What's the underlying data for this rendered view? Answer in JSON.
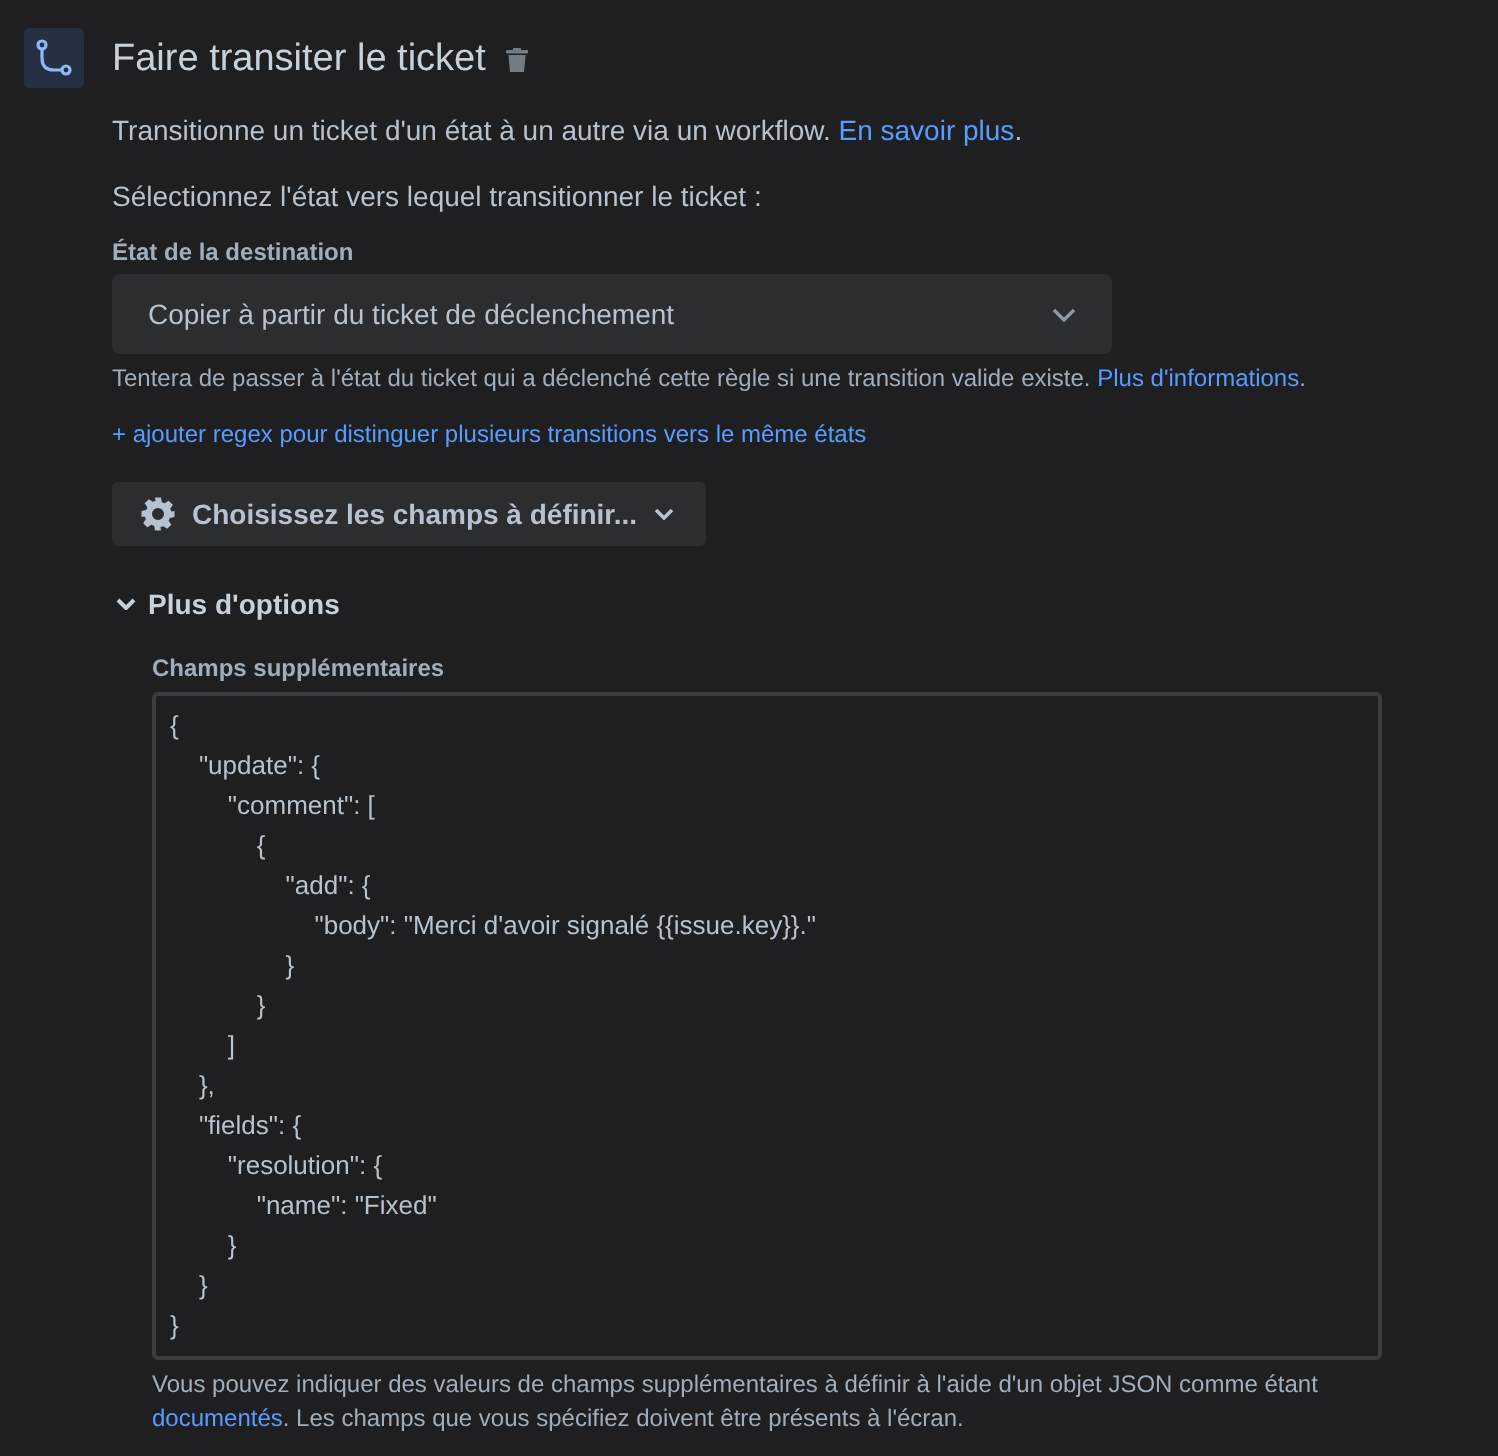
{
  "header": {
    "title": "Faire transiter le ticket"
  },
  "description": {
    "before": "Transitionne un ticket d'un état à un autre via un workflow. ",
    "link": "En savoir plus",
    "after": "."
  },
  "prompt": "Sélectionnez l'état vers lequel transitionner le ticket :",
  "destination": {
    "label": "État de la destination",
    "value": "Copier à partir du ticket de déclenchement",
    "help": {
      "before": "Tentera de passer à l'état du ticket qui a déclenché cette règle si une transition valide existe. ",
      "link": "Plus d'informations",
      "after": "."
    }
  },
  "regex_link": "+ ajouter regex pour distinguer plusieurs transitions vers le même états",
  "fields_button": "Choisissez les champs à définir...",
  "more_options": {
    "label": "Plus d'options",
    "expanded": true,
    "additional_fields": {
      "label": "Champs supplémentaires",
      "value": "{\n    \"update\": {\n        \"comment\": [\n            {\n                \"add\": {\n                    \"body\": \"Merci d'avoir signalé {{issue.key}}.\"\n                }\n            }\n        ]\n    },\n    \"fields\": {\n        \"resolution\": {\n            \"name\": \"Fixed\"\n        }\n    }\n}",
      "help": {
        "before": "Vous pouvez indiquer des valeurs de champs supplémentaires à définir à l'aide d'un objet JSON comme étant ",
        "link": "documentés",
        "after": ". Les champs que vous spécifiez doivent être présents à l'écran."
      }
    }
  }
}
